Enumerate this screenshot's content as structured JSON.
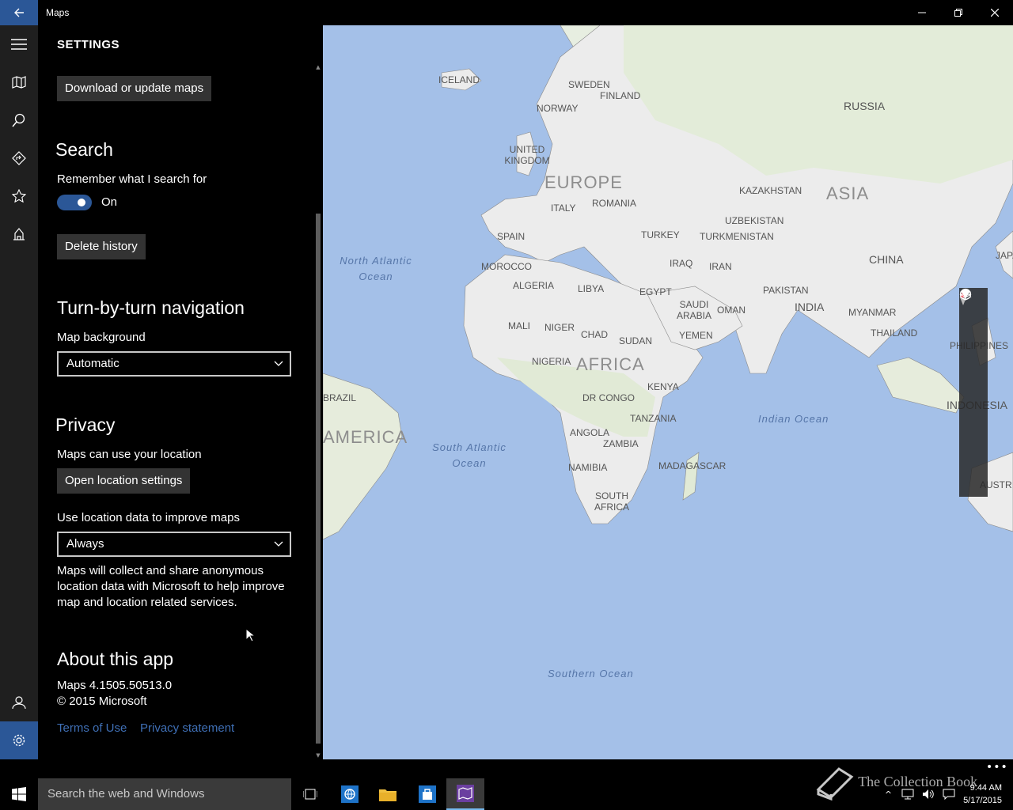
{
  "window": {
    "title": "Maps"
  },
  "rail": {
    "items": [
      "menu-icon",
      "map-icon",
      "search-icon",
      "directions-icon",
      "favorites-icon",
      "3d-cities-icon"
    ],
    "bottom": [
      "account-icon",
      "settings-icon"
    ]
  },
  "settings": {
    "title": "SETTINGS",
    "download_button": "Download or update maps",
    "search": {
      "heading": "Search",
      "remember_label": "Remember what I search for",
      "toggle_state": "On",
      "delete_button": "Delete history"
    },
    "navigation": {
      "heading": "Turn-by-turn navigation",
      "map_background_label": "Map background",
      "map_background_value": "Automatic"
    },
    "privacy": {
      "heading": "Privacy",
      "location_label": "Maps can use your location",
      "open_location_button": "Open location settings",
      "improve_label": "Use location data to improve maps",
      "improve_value": "Always",
      "description": "Maps will collect and share anonymous location data with Microsoft to help improve map and location related services."
    },
    "about": {
      "heading": "About this app",
      "version": "Maps 4.1505.50513.0",
      "copyright": "© 2015 Microsoft",
      "terms_link": "Terms of Use",
      "privacy_link": "Privacy statement"
    }
  },
  "map": {
    "regions": [
      "EUROPE",
      "ASIA",
      "AFRICA",
      "AMERICA"
    ],
    "countries": [
      "ICELAND",
      "SWEDEN",
      "FINLAND",
      "NORWAY",
      "RUSSIA",
      "UNITED KINGDOM",
      "ITALY",
      "ROMANIA",
      "KAZAKHSTAN",
      "UZBEKISTAN",
      "SPAIN",
      "TURKEY",
      "TURKMENISTAN",
      "MOROCCO",
      "CHINA",
      "ALGERIA",
      "LIBYA",
      "EGYPT",
      "IRAQ",
      "IRAN",
      "PAKISTAN",
      "SAUDI ARABIA",
      "OMAN",
      "INDIA",
      "MYANMAR",
      "MALI",
      "NIGER",
      "CHAD",
      "SUDAN",
      "YEMEN",
      "THAILAND",
      "PHILIPPINES",
      "NIGERIA",
      "KENYA",
      "DR CONGO",
      "TANZANIA",
      "ANGOLA",
      "ZAMBIA",
      "NAMIBIA",
      "MADAGASCAR",
      "SOUTH AFRICA",
      "INDONESIA",
      "BRAZIL",
      "JAPA",
      "AUSTR"
    ],
    "oceans": [
      "North Atlantic Ocean",
      "South Atlantic Ocean",
      "Indian Ocean",
      "Southern Ocean"
    ],
    "controls": [
      "compass-icon",
      "location-icon",
      "layers-icon",
      "zoom-in-icon",
      "zoom-out-icon"
    ]
  },
  "taskbar": {
    "search_placeholder": "Search the web and Windows",
    "time": "9:44 AM",
    "date": "5/17/2015",
    "watermark": "The Collection Book"
  }
}
